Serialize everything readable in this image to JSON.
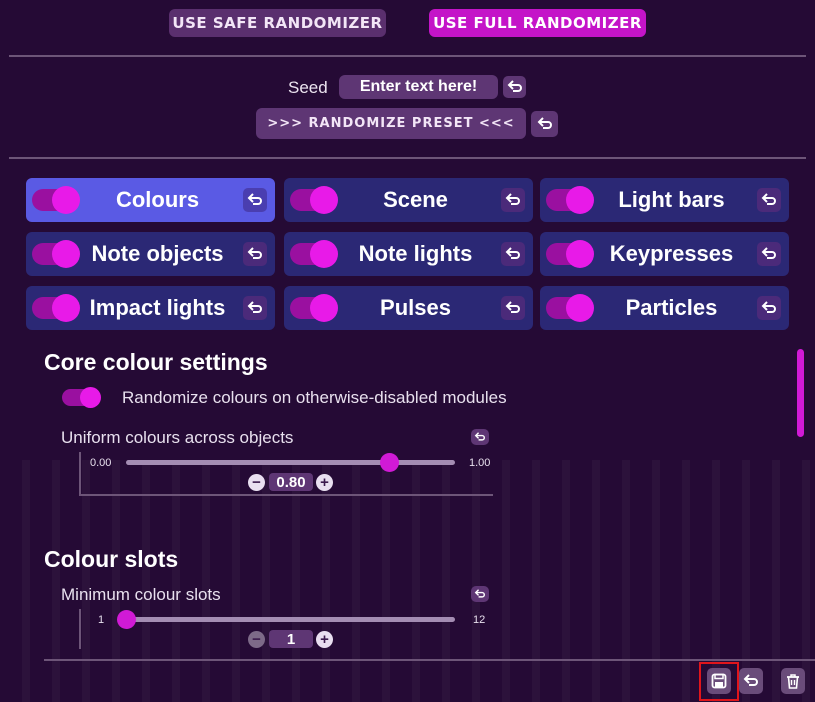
{
  "header": {
    "safe_label": "USE SAFE RANDOMIZER",
    "full_label": "USE FULL RANDOMIZER"
  },
  "seed": {
    "label": "Seed",
    "placeholder": "Enter text here!",
    "randomize_label": ">>> RANDOMIZE PRESET <<<"
  },
  "modules": [
    {
      "label": "Colours",
      "enabled": true,
      "selected": true
    },
    {
      "label": "Scene",
      "enabled": true,
      "selected": false
    },
    {
      "label": "Light bars",
      "enabled": true,
      "selected": false
    },
    {
      "label": "Note objects",
      "enabled": true,
      "selected": false
    },
    {
      "label": "Note lights",
      "enabled": true,
      "selected": false
    },
    {
      "label": "Keypresses",
      "enabled": true,
      "selected": false
    },
    {
      "label": "Impact lights",
      "enabled": true,
      "selected": false
    },
    {
      "label": "Pulses",
      "enabled": true,
      "selected": false
    },
    {
      "label": "Particles",
      "enabled": true,
      "selected": false
    }
  ],
  "core": {
    "title": "Core colour settings",
    "randomize_disabled_label": "Randomize colours on otherwise-disabled modules",
    "randomize_disabled_on": true,
    "uniform": {
      "label": "Uniform colours across objects",
      "min_label": "0.00",
      "max_label": "1.00",
      "value_label": "0.80",
      "value": 0.8
    }
  },
  "slots": {
    "title": "Colour slots",
    "min_slots": {
      "label": "Minimum colour slots",
      "min_label": "1",
      "max_label": "12",
      "value_label": "1",
      "value": 1
    }
  },
  "colors": {
    "accent": "#d11ad6",
    "module_bg": "#2b2875",
    "module_selected": "#5a5ae4",
    "background": "#250a35"
  },
  "icons": {
    "reset": "reset-arrow-icon",
    "save": "save-icon",
    "delete": "trash-icon"
  }
}
